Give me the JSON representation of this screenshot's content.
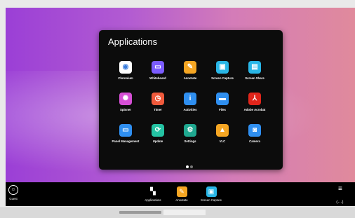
{
  "panel": {
    "title": "Applications"
  },
  "apps": [
    {
      "label": "Chromium",
      "icon": "chromium-icon",
      "color": "#ffffff"
    },
    {
      "label": "Whiteboard",
      "icon": "whiteboard-icon",
      "color": "#7b5cff"
    },
    {
      "label": "Annotate",
      "icon": "annotate-icon",
      "color": "#f5a623"
    },
    {
      "label": "Screen Capture",
      "icon": "screen-capture-icon",
      "color": "#29b6e6"
    },
    {
      "label": "Screen Share",
      "icon": "screen-share-icon",
      "color": "#29b6e6"
    },
    {
      "label": "Spinner",
      "icon": "spinner-icon",
      "color": "#d64fd6"
    },
    {
      "label": "Timer",
      "icon": "timer-icon",
      "color": "#f05a3c"
    },
    {
      "label": "Activities",
      "icon": "activities-icon",
      "color": "#2f8ff0"
    },
    {
      "label": "Files",
      "icon": "files-icon",
      "color": "#2f8ff0"
    },
    {
      "label": "Adobe Acrobat",
      "icon": "acrobat-icon",
      "color": "#e1251b"
    },
    {
      "label": "Panel Management",
      "icon": "panel-management-icon",
      "color": "#2f8ff0"
    },
    {
      "label": "Update",
      "icon": "update-icon",
      "color": "#24c3a3"
    },
    {
      "label": "Settings",
      "icon": "settings-icon",
      "color": "#1fa890"
    },
    {
      "label": "VLC",
      "icon": "vlc-icon",
      "color": "#f5a623"
    },
    {
      "label": "Camera",
      "icon": "camera-icon",
      "color": "#2f8ff0"
    }
  ],
  "taskbar": {
    "guest": "Guest",
    "items": [
      {
        "label": "Applications",
        "icon": "grid-icon",
        "color": "#000000"
      },
      {
        "label": "Annotate",
        "icon": "annotate-icon",
        "color": "#f5a623"
      },
      {
        "label": "Screen Capture",
        "icon": "screen-capture-icon",
        "color": "#29b6e6"
      }
    ],
    "menu": "≡",
    "nav": "⟨···⟩"
  }
}
